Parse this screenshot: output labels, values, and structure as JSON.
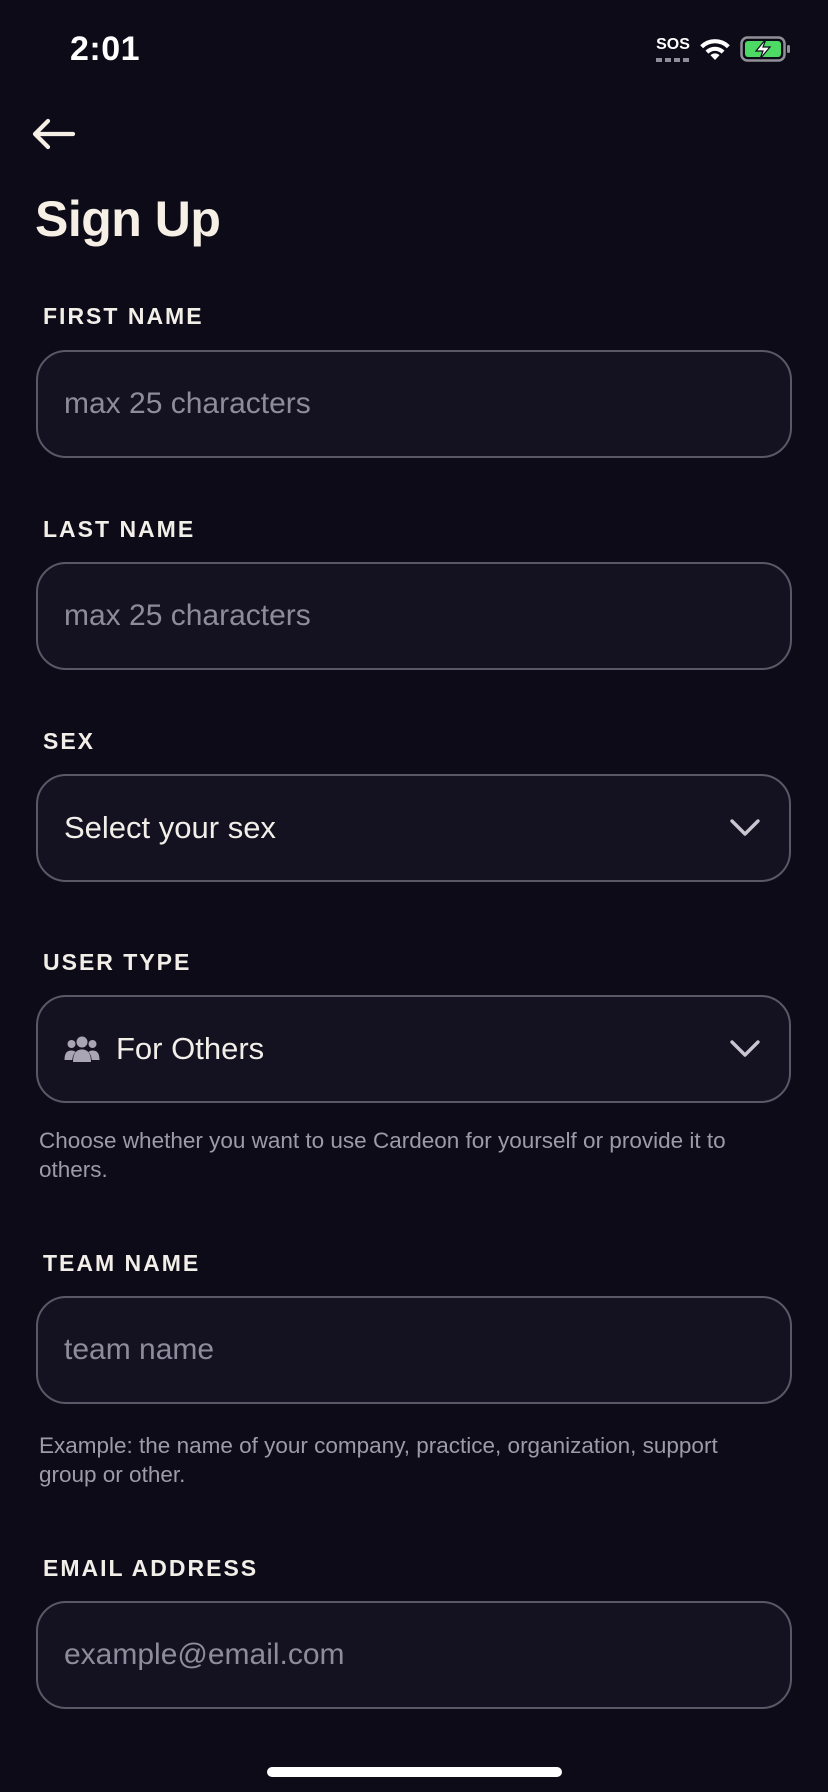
{
  "status_bar": {
    "time": "2:01",
    "sos": "SOS",
    "battery_color": "#4cd964"
  },
  "header": {
    "back_icon": "arrow-left-icon",
    "title": "Sign Up"
  },
  "form": {
    "first_name": {
      "label": "FIRST NAME",
      "value": "",
      "placeholder": "max 25 characters"
    },
    "last_name": {
      "label": "LAST NAME",
      "value": "",
      "placeholder": "max 25 characters"
    },
    "sex": {
      "label": "SEX",
      "selected": "Select your sex",
      "icon": "chevron-down-icon"
    },
    "user_type": {
      "label": "USER TYPE",
      "selected": "For Others",
      "icon": "users-icon",
      "helper": "Choose whether you want to use Cardeon for yourself or provide it to others."
    },
    "team_name": {
      "label": "TEAM NAME",
      "value": "",
      "placeholder": "team name",
      "helper": "Example: the name of your company, practice, organization, support group or other."
    },
    "email": {
      "label": "EMAIL ADDRESS",
      "value": "",
      "placeholder": "example@email.com"
    }
  },
  "colors": {
    "background": "#0d0b18",
    "field_background": "#141121",
    "field_border": "#5a5766",
    "text": "#f2eee8",
    "placeholder": "#8e8b9a"
  }
}
